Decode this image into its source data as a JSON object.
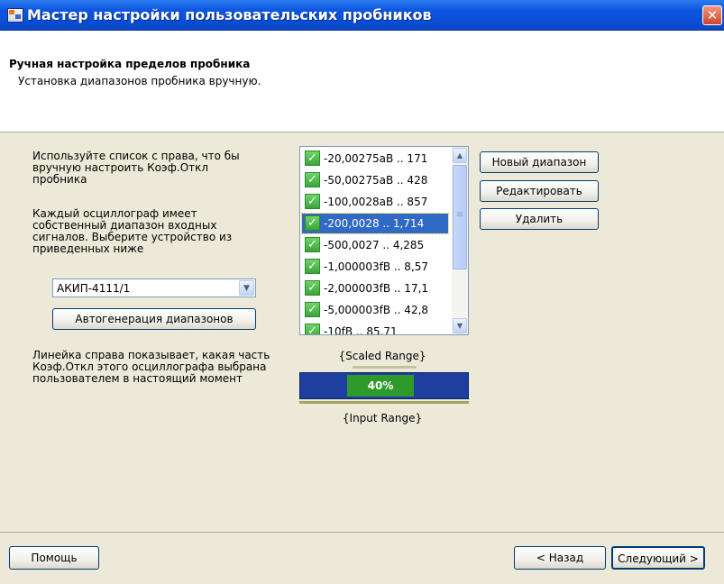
{
  "window": {
    "title": "Мастер настройки пользовательских пробников",
    "close_glyph": "✕"
  },
  "header": {
    "title": "Ручная настройка пределов пробника",
    "subtitle": "Установка диапазонов пробника вручную."
  },
  "left": {
    "instruction1": "Используйте список с права, что бы вручную настроить Коэф.Откл пробника",
    "instruction2": "Каждый осциллограф имеет собственный диапазон входных сигналов. Выберите устройство из приведенных ниже",
    "device_select": {
      "value": "АКИП-4111/1"
    },
    "autogen_button": "Автогенерация диапазонов",
    "instruction3": "Линейка справа показывает, какая часть Коэф.Откл этого осциллографа выбрана пользователем в настоящий момент"
  },
  "ranges_list": {
    "items": [
      {
        "label": "-20,00275аВ .. 171",
        "checked": true,
        "selected": false
      },
      {
        "label": "-50,00275аВ .. 428",
        "checked": true,
        "selected": false
      },
      {
        "label": "-100,0028аВ .. 857",
        "checked": true,
        "selected": false
      },
      {
        "label": "-200,0028 .. 1,714",
        "checked": true,
        "selected": true
      },
      {
        "label": "-500,0027 .. 4,285",
        "checked": true,
        "selected": false
      },
      {
        "label": "-1,000003fВ .. 8,57",
        "checked": true,
        "selected": false
      },
      {
        "label": "-2,000003fВ .. 17,1",
        "checked": true,
        "selected": false
      },
      {
        "label": "-5,000003fВ .. 42,8",
        "checked": true,
        "selected": false
      },
      {
        "label": "-10fВ .. 85,71",
        "checked": true,
        "selected": false
      }
    ]
  },
  "actions": {
    "new_range": "Новый диапазон",
    "edit": "Редактировать",
    "delete": "Удалить"
  },
  "range_indicator": {
    "scaled_label": "{Scaled Range}",
    "input_label": "{Input Range}",
    "percent_text": "40%",
    "fill_start_fraction": 0.28,
    "fill_fraction": 0.4,
    "bar_color": "#1e3f9e",
    "fill_color": "#2f9a2c"
  },
  "footer": {
    "help": "Помощь",
    "back": "< Назад",
    "next": "Следующий >"
  },
  "colors": {
    "titlebar": "#0a4fd6",
    "dialog_bg": "#ece9d8",
    "selection": "#316ac5"
  }
}
